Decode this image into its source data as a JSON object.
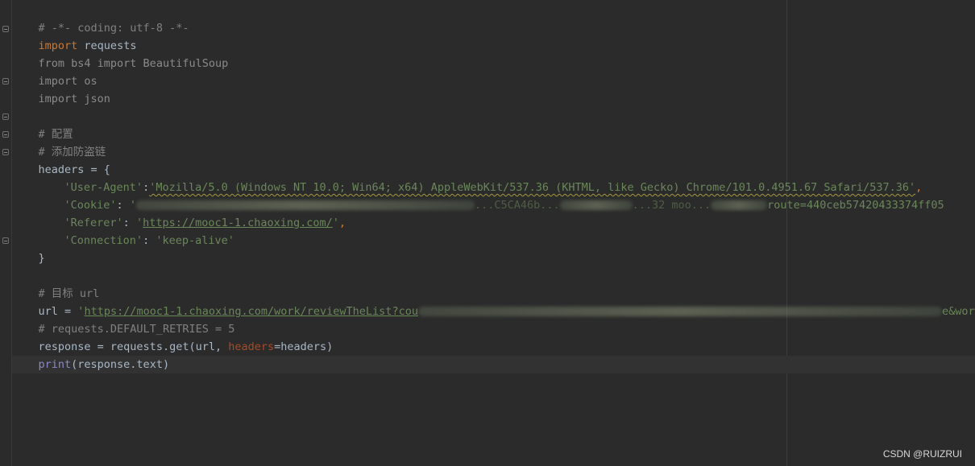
{
  "code": {
    "l1_comment": "# -*- coding: utf-8 -*-",
    "l2_kw": "import",
    "l2_mod": " requests",
    "l3_text": "from bs4 import BeautifulSoup",
    "l4_text": "import os",
    "l5_text": "import json",
    "l6_comment": "# 配置",
    "l7_comment": "# 添加防盗链",
    "l8_text": "headers = {",
    "l9_key": "'User-Agent'",
    "l9_colon": ":",
    "l9_value": "'Mozilla/5.0 (Windows NT 10.0; Win64; x64) AppleWebKit/537.36 (KHTML, like Gecko) Chrome/101.0.4951.67 Safari/537.36'",
    "l9_comma": ",",
    "l10_key": "'Cookie'",
    "l10_colon": ": ",
    "l10_visible_a": "'",
    "l10_visible_b": "...C5CA46b...",
    "l10_visible_c": "...32 moo...",
    "l10_visible_d": "route=440ceb57420433374ff05",
    "l11_key": "'Referer'",
    "l11_colon": ": ",
    "l11_q1": "'",
    "l11_url": "https://mooc1-1.chaoxing.com/",
    "l11_q2": "'",
    "l11_comma": ",",
    "l12_key": "'Connection'",
    "l12_colon": ": ",
    "l12_value": "'keep-alive'",
    "l13_text": "}",
    "l14_comment": "# 目标 url",
    "l15_prefix": "url = ",
    "l15_q": "'",
    "l15_url": "https://mooc1-1.chaoxing.com/work/reviewTheList?cou",
    "l15_tail": "e&workSys",
    "l16_comment": "# requests.DEFAULT_RETRIES = 5",
    "l17_prefix": "response = requests.get(url, ",
    "l17_param": "headers",
    "l17_suffix": "=headers)",
    "l18_builtin": "print",
    "l18_suffix": "(response.text)"
  },
  "watermark": "CSDN @RUIZRUI"
}
